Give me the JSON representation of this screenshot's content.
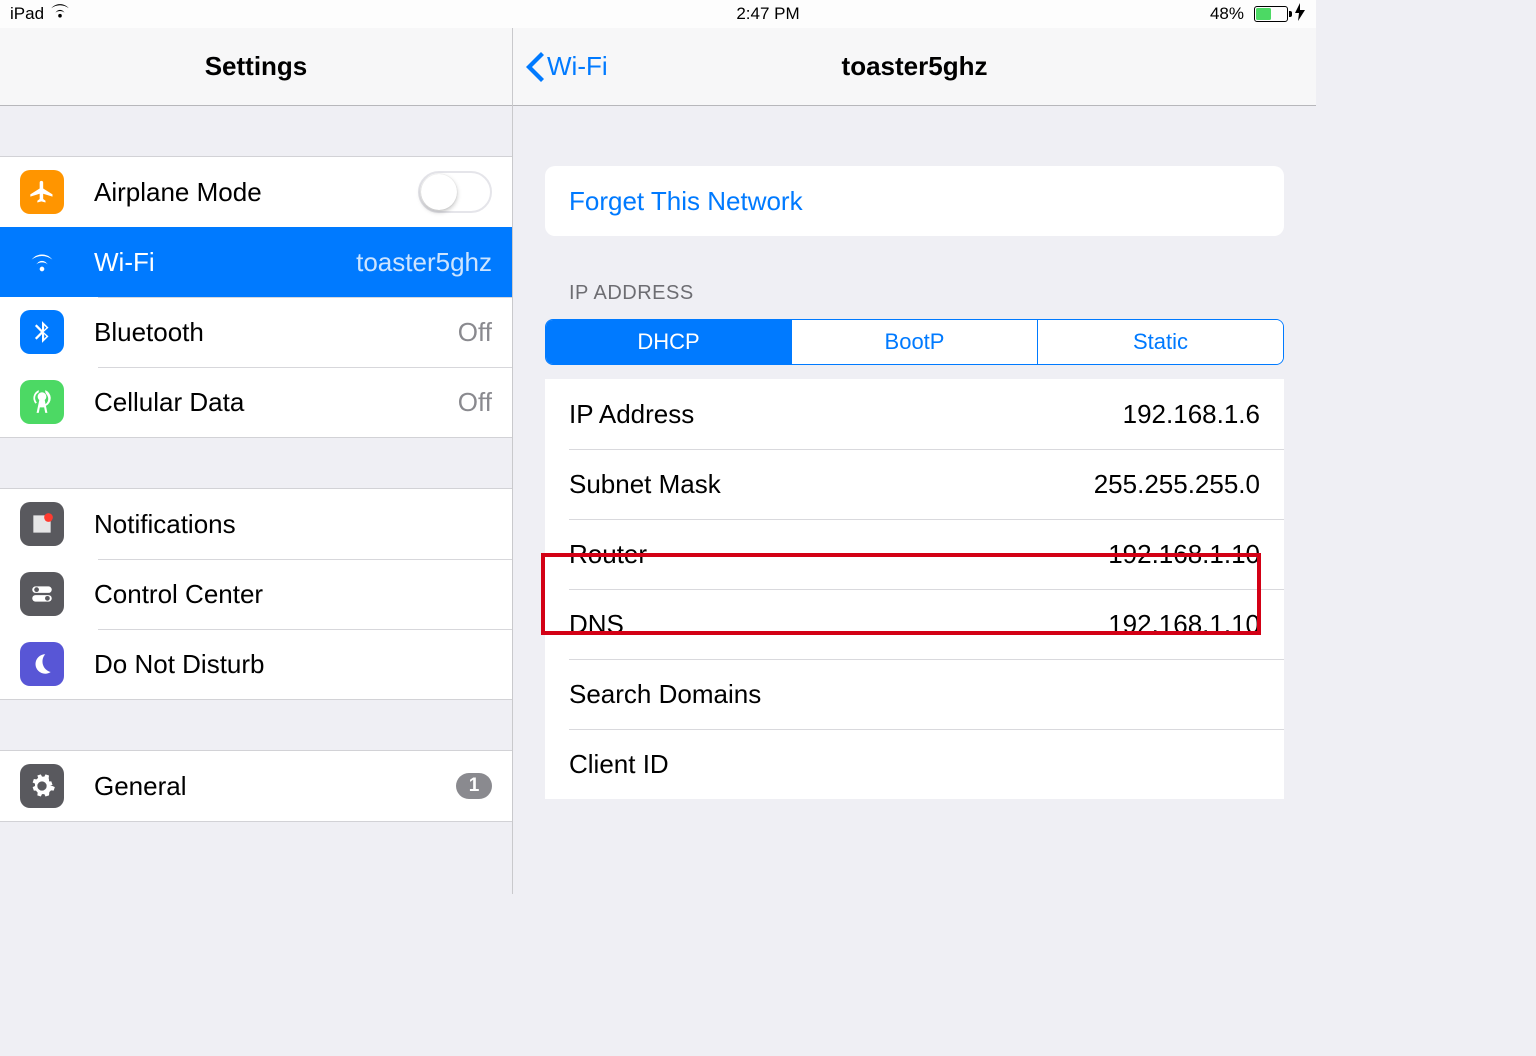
{
  "status": {
    "device": "iPad",
    "time": "2:47 PM",
    "battery_text": "48%"
  },
  "master": {
    "title": "Settings",
    "g1": {
      "airplane": "Airplane Mode",
      "wifi": "Wi-Fi",
      "wifi_value": "toaster5ghz",
      "bluetooth": "Bluetooth",
      "bluetooth_value": "Off",
      "cellular": "Cellular Data",
      "cellular_value": "Off"
    },
    "g2": {
      "notifications": "Notifications",
      "control_center": "Control Center",
      "dnd": "Do Not Disturb"
    },
    "g3": {
      "general": "General",
      "general_badge": "1"
    }
  },
  "detail": {
    "back": "Wi-Fi",
    "title": "toaster5ghz",
    "forget": "Forget This Network",
    "ip_section": "IP ADDRESS",
    "seg": {
      "dhcp": "DHCP",
      "bootp": "BootP",
      "static": "Static"
    },
    "rows": {
      "ip_addr_k": "IP Address",
      "ip_addr_v": "192.168.1.6",
      "subnet_k": "Subnet Mask",
      "subnet_v": "255.255.255.0",
      "router_k": "Router",
      "router_v": "192.168.1.10",
      "dns_k": "DNS",
      "dns_v": "192.168.1.10",
      "search_k": "Search Domains",
      "search_v": "",
      "client_k": "Client ID",
      "client_v": ""
    }
  }
}
